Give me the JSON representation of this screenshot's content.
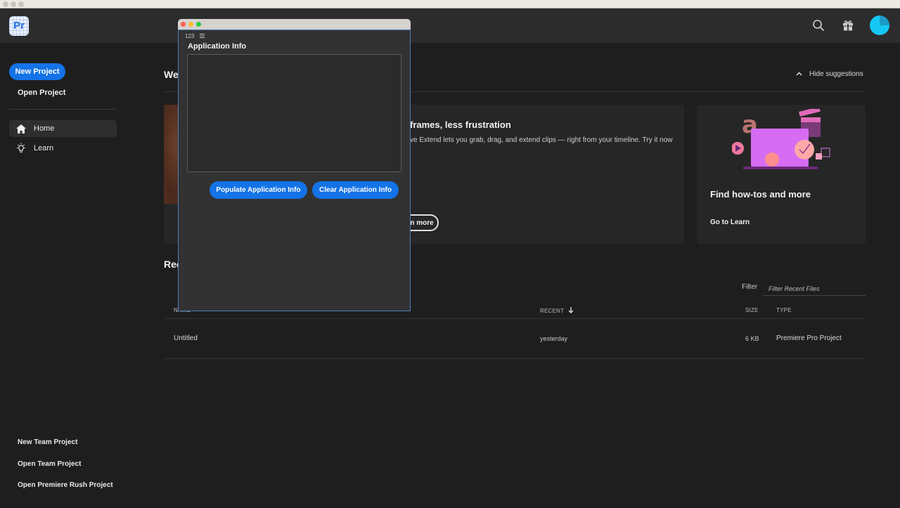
{
  "app": {
    "logo_text": "Pr",
    "accent": "#1473e6"
  },
  "topbar": {
    "icons": [
      "search-icon",
      "gift-icon",
      "avatar"
    ]
  },
  "sidebar": {
    "new_project": "New Project",
    "open_project": "Open Project",
    "nav": [
      {
        "label": "Home",
        "icon": "home-icon",
        "active": true
      },
      {
        "label": "Learn",
        "icon": "lightbulb-icon",
        "active": false
      }
    ],
    "bottom_links": [
      "New Team Project",
      "Open Team Project",
      "Open Premiere Rush Project"
    ]
  },
  "main": {
    "welcome_title": "Wel",
    "hide_suggestions": "Hide suggestions",
    "feature_card": {
      "title": "frames, less frustration",
      "description": "ve Extend lets you grab, drag, and extend clips — right from your timeline. Try it now",
      "button": "n more"
    },
    "learn_card": {
      "title": "Find how-tos and more",
      "link": "Go to Learn"
    },
    "recent": {
      "title": "Rec",
      "filter_label": "Filter",
      "filter_placeholder": "Filter Recent Files",
      "columns": {
        "name": "NAME",
        "recent": "RECENT",
        "size": "SIZE",
        "type": "TYPE"
      },
      "rows": [
        {
          "name": "Untitled",
          "recent": "yesterday",
          "size": "6 KB",
          "type": "Premiere Pro Project"
        }
      ]
    }
  },
  "panel": {
    "tab_label": "123",
    "menu_icon": "hamburger-icon",
    "heading": "Application Info",
    "textarea_value": "",
    "populate_button": "Populate Application Info",
    "clear_button": "Clear Application Info"
  }
}
